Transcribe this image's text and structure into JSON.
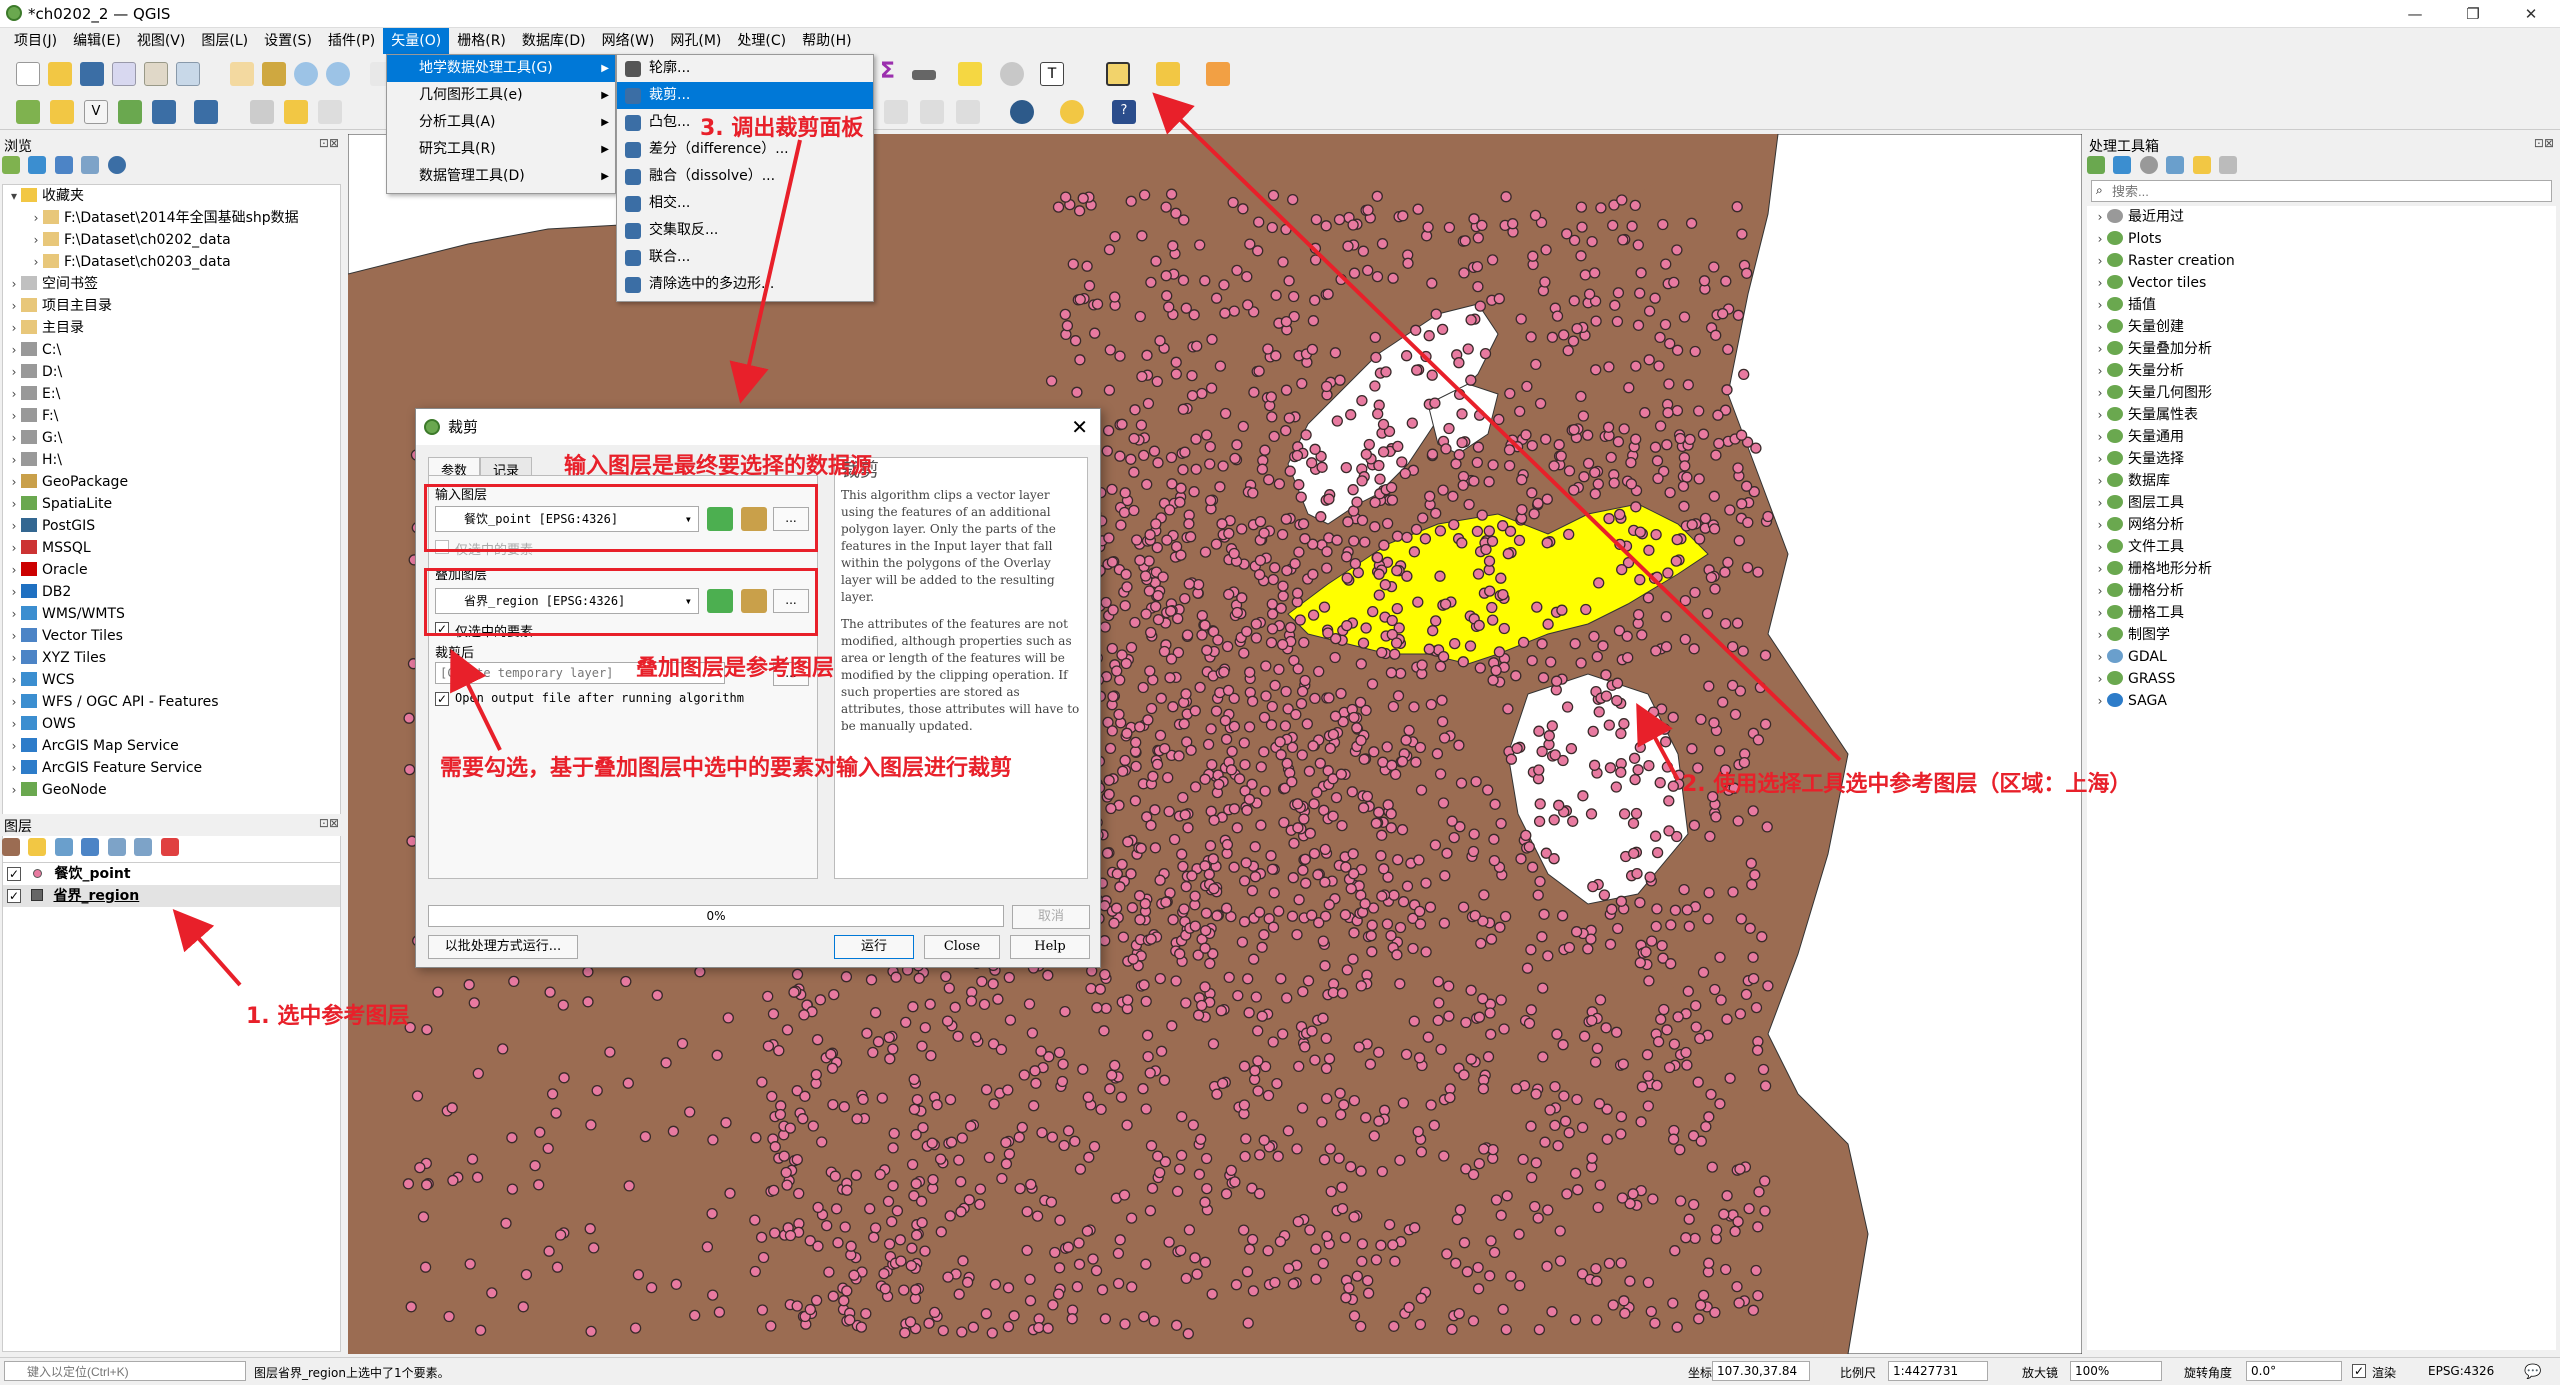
{
  "window": {
    "title": "*ch0202_2 — QGIS",
    "controls": [
      "—",
      "❐",
      "✕"
    ]
  },
  "menubar": [
    "项目(J)",
    "编辑(E)",
    "视图(V)",
    "图层(L)",
    "设置(S)",
    "插件(P)",
    "矢量(O)",
    "栅格(R)",
    "数据库(D)",
    "网络(W)",
    "网孔(M)",
    "处理(C)",
    "帮助(H)"
  ],
  "vector_menu": {
    "items": [
      "地学数据处理工具(G)",
      "几何图形工具(e)",
      "分析工具(A)",
      "研究工具(R)",
      "数据管理工具(D)"
    ],
    "selected": "地学数据处理工具(G)"
  },
  "geoprocessing_submenu": {
    "items": [
      "轮廓...",
      "裁剪...",
      "凸包...",
      "差分（difference）...",
      "融合（dissolve）...",
      "相交...",
      "交集取反...",
      "联合...",
      "清除选中的多边形..."
    ],
    "selected": "裁剪..."
  },
  "browser_panel": {
    "title": "浏览",
    "items": [
      {
        "label": "收藏夹",
        "level": 0,
        "expanded": true,
        "icon": "star-icon"
      },
      {
        "label": "F:\\Dataset\\2014年全国基础shp数据",
        "level": 1,
        "icon": "folder-icon"
      },
      {
        "label": "F:\\Dataset\\ch0202_data",
        "level": 1,
        "icon": "folder-icon"
      },
      {
        "label": "F:\\Dataset\\ch0203_data",
        "level": 1,
        "icon": "folder-icon"
      },
      {
        "label": "空间书签",
        "level": 0,
        "icon": "bookmark-icon"
      },
      {
        "label": "项目主目录",
        "level": 0,
        "icon": "folder-icon"
      },
      {
        "label": "主目录",
        "level": 0,
        "icon": "folder-icon"
      },
      {
        "label": "C:\\",
        "level": 0,
        "icon": "drive-icon"
      },
      {
        "label": "D:\\",
        "level": 0,
        "icon": "drive-icon"
      },
      {
        "label": "E:\\",
        "level": 0,
        "icon": "drive-icon"
      },
      {
        "label": "F:\\",
        "level": 0,
        "icon": "drive-icon"
      },
      {
        "label": "G:\\",
        "level": 0,
        "icon": "drive-icon"
      },
      {
        "label": "H:\\",
        "level": 0,
        "icon": "drive-icon"
      },
      {
        "label": "GeoPackage",
        "level": 0,
        "icon": "geopackage-icon"
      },
      {
        "label": "SpatiaLite",
        "level": 0,
        "icon": "spatialite-icon"
      },
      {
        "label": "PostGIS",
        "level": 0,
        "icon": "postgis-icon"
      },
      {
        "label": "MSSQL",
        "level": 0,
        "icon": "mssql-icon"
      },
      {
        "label": "Oracle",
        "level": 0,
        "icon": "oracle-icon"
      },
      {
        "label": "DB2",
        "level": 0,
        "icon": "db2-icon"
      },
      {
        "label": "WMS/WMTS",
        "level": 0,
        "icon": "globe-icon"
      },
      {
        "label": "Vector Tiles",
        "level": 0,
        "icon": "vector-tiles-icon"
      },
      {
        "label": "XYZ Tiles",
        "level": 0,
        "icon": "xyz-tiles-icon"
      },
      {
        "label": "WCS",
        "level": 0,
        "icon": "globe-icon"
      },
      {
        "label": "WFS / OGC API - Features",
        "level": 0,
        "icon": "globe-icon"
      },
      {
        "label": "OWS",
        "level": 0,
        "icon": "globe-icon"
      },
      {
        "label": "ArcGIS Map Service",
        "level": 0,
        "icon": "arcgis-icon"
      },
      {
        "label": "ArcGIS Feature Service",
        "level": 0,
        "icon": "arcgis-icon"
      },
      {
        "label": "GeoNode",
        "level": 0,
        "icon": "geonode-icon"
      }
    ]
  },
  "layers_panel": {
    "title": "图层",
    "layers": [
      {
        "name": "餐饮_point",
        "checked": true,
        "bold": true
      },
      {
        "name": "省界_region",
        "checked": true,
        "bold": true,
        "selected": true
      }
    ]
  },
  "processing_toolbox": {
    "title": "处理工具箱",
    "search_placeholder": "搜索...",
    "items": [
      "最近用过",
      "Plots",
      "Raster creation",
      "Vector tiles",
      "插值",
      "矢量创建",
      "矢量叠加分析",
      "矢量分析",
      "矢量几何图形",
      "矢量属性表",
      "矢量通用",
      "矢量选择",
      "数据库",
      "图层工具",
      "网络分析",
      "文件工具",
      "栅格地形分析",
      "栅格分析",
      "栅格工具",
      "制图学",
      "GDAL",
      "GRASS",
      "SAGA"
    ]
  },
  "clip_dialog": {
    "title": "裁剪",
    "tabs": [
      "参数",
      "记录"
    ],
    "input_label": "输入图层",
    "input_value": "餐饮_point [EPSG:4326]",
    "input_selected_only": "仅选中的要素",
    "overlay_label": "叠加图层",
    "overlay_value": "省界_region [EPSG:4326]",
    "overlay_selected_only": "仅选中的要素",
    "output_label": "裁剪后",
    "output_placeholder": "[Create temporary layer]",
    "open_output": "Open output file after running algorithm",
    "help_title": "裁剪",
    "help_text": "This algorithm clips a vector layer using the features of an additional polygon layer. Only the parts of the features in the Input layer that fall within the polygons of the Overlay layer will be added to the resulting layer.",
    "help_text2": "The attributes of the features are not modified, although properties such as area or length of the features will be modified by the clipping operation. If such properties are stored as attributes, those attributes will have to be manually updated.",
    "progress": "0%",
    "progress_value": 0,
    "cancel": "取消",
    "batch": "以批处理方式运行...",
    "run": "运行",
    "close": "Close",
    "help": "Help",
    "dots": "..."
  },
  "annotations": {
    "step1": "1. 选中参考图层",
    "step2": "2. 使用选择工具选中参考图层（区域：上海）",
    "step3": "3. 调出裁剪面板",
    "input_note": "输入图层是最终要选择的数据源",
    "overlay_note": "叠加图层是参考图层",
    "check_note": "需要勾选，基于叠加图层中选中的要素对输入图层进行裁剪"
  },
  "statusbar": {
    "locator_placeholder": "键入以定位(Ctrl+K)",
    "message": "图层省界_region上选中了1个要素。",
    "coord_label": "坐标",
    "coord": "107.30,37.84",
    "scale_label": "比例尺",
    "scale": "1:4427731",
    "zoom_label": "放大镜",
    "zoom": "100%",
    "rotation_label": "旋转角度",
    "rotation": "0.0°",
    "render": "渲染",
    "crs": "EPSG:4326"
  },
  "colors": {
    "land": "#9b6c52",
    "points": "#e87aa0",
    "selected": "#ffff00",
    "water": "#ffffff",
    "annotation": "#e8202a",
    "highlight": "#0078d7"
  }
}
